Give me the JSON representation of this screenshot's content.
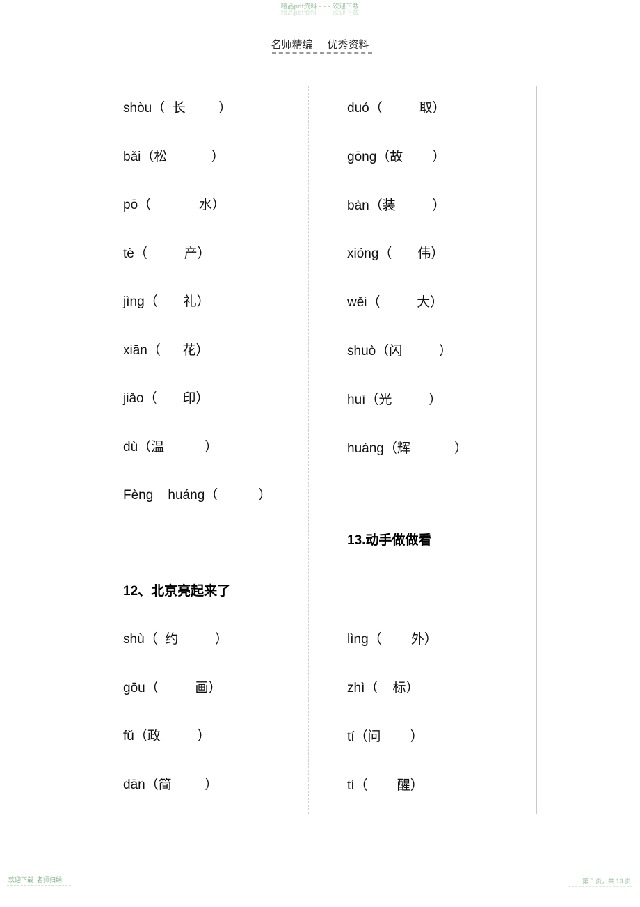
{
  "watermark": {
    "top": "精品pdf资料 - - - 欢迎下载",
    "footer_left": "欢迎下载  名师归纳",
    "footer_right": "第 5 页，共 13 页"
  },
  "header": {
    "title": "名师精编     优秀资料"
  },
  "colors": {
    "watermark_green": "#8fbf92",
    "text_black": "#111111",
    "border_gray": "#d2d2d2"
  },
  "left_column": {
    "entries_top": [
      {
        "text": "shòu（  长         ）"
      },
      {
        "text": "bǎi（松            ）"
      },
      {
        "text": "pō（             水）"
      },
      {
        "text": "tè（          产）"
      },
      {
        "text": "jìng（       礼）"
      },
      {
        "text": "xiān（      花）"
      },
      {
        "text": "jiǎo（       印）"
      },
      {
        "text": "dù（温           ）"
      },
      {
        "text": "Fèng    huáng（           ）"
      }
    ],
    "section_title": "12、北京亮起来了",
    "entries_bottom": [
      {
        "text": "shù（  约          ）"
      },
      {
        "text": "gōu（          画）"
      },
      {
        "text": "fǔ（政          ）"
      },
      {
        "text": "dān（简         ）"
      }
    ]
  },
  "right_column": {
    "entries_top": [
      {
        "text": "duó（          取）"
      },
      {
        "text": "gōng（故        ）"
      },
      {
        "text": "bàn（装          ）"
      },
      {
        "text": "xióng（       伟）"
      },
      {
        "text": "wěi（          大）"
      },
      {
        "text": "shuò（闪          ）"
      },
      {
        "text": "huī（光          ）"
      },
      {
        "text": "huáng（辉            ）"
      }
    ],
    "section_title": "13.动手做做看",
    "entries_bottom": [
      {
        "text": "lìng（        外）"
      },
      {
        "text": "zhì（    标）"
      },
      {
        "text": "tí（问        ）"
      },
      {
        "text": "tí（        醒）"
      }
    ]
  }
}
